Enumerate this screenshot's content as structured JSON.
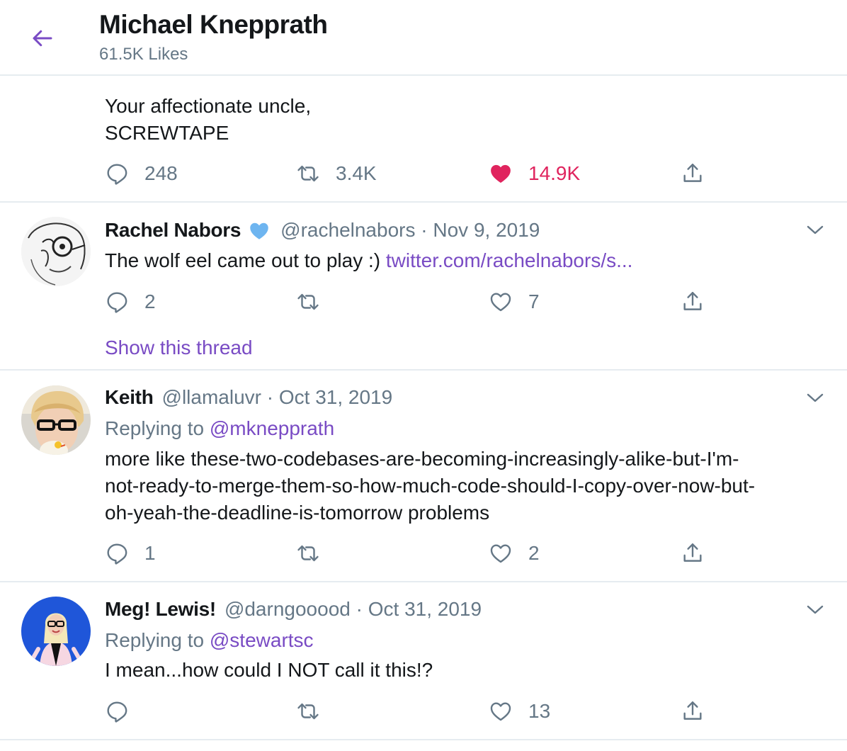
{
  "header": {
    "title": "Michael Knepprath",
    "subtitle": "61.5K Likes"
  },
  "colors": {
    "accent": "#794bc4",
    "like": "#e0245e",
    "muted": "#657786",
    "verified": "#6eb5f0",
    "divider": "#e6ecf0"
  },
  "tweets": [
    {
      "text_lines": [
        "Your affectionate uncle,",
        "SCREWTAPE"
      ],
      "reply_count": "248",
      "retweet_count": "3.4K",
      "like_count": "14.9K",
      "liked": true
    },
    {
      "name": "Rachel Nabors",
      "verified": true,
      "handle": "@rachelnabors",
      "date": "Nov 9, 2019",
      "text": "The wolf eel came out to play :) ",
      "link": "twitter.com/rachelnabors/s...",
      "reply_count": "2",
      "retweet_count": "",
      "like_count": "7",
      "show_thread": "Show this thread"
    },
    {
      "name": "Keith",
      "handle": "@llamaluvr",
      "date": "Oct 31, 2019",
      "replying_label": "Replying to ",
      "replying_to": "@mknepprath",
      "text_lines": [
        "more like these-two-codebases-are-becoming-increasingly-alike-but-I'm-",
        "not-ready-to-merge-them-so-how-much-code-should-I-copy-over-now-but-",
        "oh-yeah-the-deadline-is-tomorrow problems"
      ],
      "reply_count": "1",
      "retweet_count": "",
      "like_count": "2"
    },
    {
      "name": "Meg! Lewis!",
      "handle": "@darngooood",
      "date": "Oct 31, 2019",
      "replying_label": "Replying to ",
      "replying_to": "@stewartsc",
      "text": "I mean...how could I NOT call it this!?",
      "reply_count": "",
      "retweet_count": "",
      "like_count": "13"
    }
  ],
  "separator": " · ",
  "icons": [
    "back-arrow-icon",
    "reply-icon",
    "retweet-icon",
    "heart-icon",
    "share-icon",
    "chevron-down-icon",
    "verified-badge-icon"
  ]
}
